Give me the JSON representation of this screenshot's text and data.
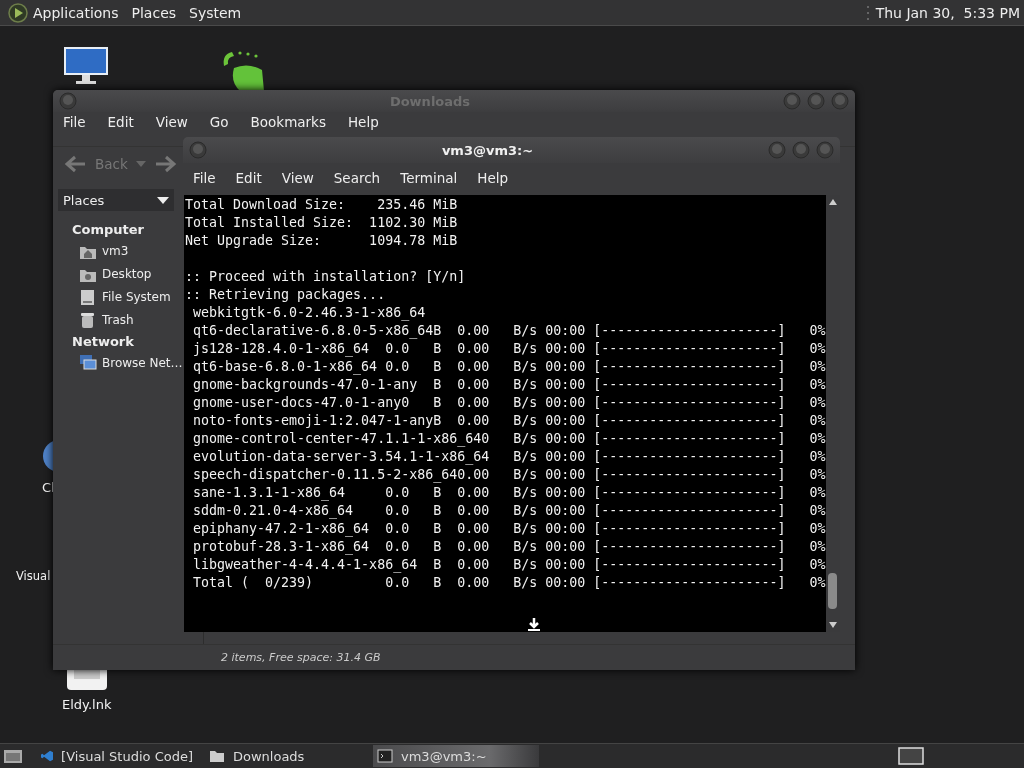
{
  "top_panel": {
    "menus": [
      "Applications",
      "Places",
      "System"
    ],
    "clock": "Thu Jan 30,  5:33 PM"
  },
  "desktop_icons": [
    {
      "kind": "computer"
    },
    {
      "kind": "eldy"
    },
    {
      "kind": "globe",
      "label": "Cl"
    },
    {
      "kind": "blank",
      "label": "Visual"
    },
    {
      "kind": "shortcut",
      "label": "Eldy.lnk"
    }
  ],
  "file_manager": {
    "title": "Downloads",
    "active": false,
    "menus": [
      "File",
      "Edit",
      "View",
      "Go",
      "Bookmarks",
      "Help"
    ],
    "toolbar": {
      "back": {
        "label": "Back",
        "disabled": true
      }
    },
    "sidebar": {
      "selector": "Places",
      "sections": [
        {
          "heading": "Computer",
          "items": [
            {
              "label": "vm3",
              "kind": "home"
            },
            {
              "label": "Desktop",
              "kind": "folder"
            },
            {
              "label": "File System",
              "kind": "drive"
            },
            {
              "label": "Trash",
              "kind": "trash"
            }
          ]
        },
        {
          "heading": "Network",
          "items": [
            {
              "label": "Browse Net…",
              "kind": "network"
            }
          ]
        }
      ]
    },
    "status": "2 items, Free space: 31.4 GB"
  },
  "terminal": {
    "title": "vm3@vm3:~",
    "active": true,
    "menus": [
      "File",
      "Edit",
      "View",
      "Search",
      "Terminal",
      "Help"
    ],
    "summary": [
      "Total Download Size:    235.46 MiB",
      "Total Installed Size:  1102.30 MiB",
      "Net Upgrade Size:      1094.78 MiB"
    ],
    "messages": [
      ":: Proceed with installation? [Y/n]",
      ":: Retrieving packages..."
    ],
    "progress": [
      " webkitgtk-6.0-2.46.3-1-x86_64",
      " qt6-declarative-6.8.0-5-x86_64B  0.00   B/s 00:00 [----------------------]   0%",
      " js128-128.4.0-1-x86_64  0.0   B  0.00   B/s 00:00 [----------------------]   0%",
      " qt6-base-6.8.0-1-x86_64 0.0   B  0.00   B/s 00:00 [----------------------]   0%",
      " gnome-backgrounds-47.0-1-any  B  0.00   B/s 00:00 [----------------------]   0%",
      " gnome-user-docs-47.0-1-any0   B  0.00   B/s 00:00 [----------------------]   0%",
      " noto-fonts-emoji-1:2.047-1-anyB  0.00   B/s 00:00 [----------------------]   0%",
      " gnome-control-center-47.1.1-1-x86_640   B/s 00:00 [----------------------]   0%",
      " evolution-data-server-3.54.1-1-x86_64   B/s 00:00 [----------------------]   0%",
      " speech-dispatcher-0.11.5-2-x86_640.00   B/s 00:00 [----------------------]   0%",
      " sane-1.3.1-1-x86_64     0.0   B  0.00   B/s 00:00 [----------------------]   0%",
      " sddm-0.21.0-4-x86_64    0.0   B  0.00   B/s 00:00 [----------------------]   0%",
      " epiphany-47.2-1-x86_64  0.0   B  0.00   B/s 00:00 [----------------------]   0%",
      " protobuf-28.3-1-x86_64  0.0   B  0.00   B/s 00:00 [----------------------]   0%",
      " libgweather-4-4.4.4-1-x86_64  B  0.00   B/s 00:00 [----------------------]   0%",
      " Total (  0/239)         0.0   B  0.00   B/s 00:00 [----------------------]   0%"
    ]
  },
  "taskbar": {
    "items": [
      {
        "label": "[Visual Studio Code]",
        "kind": "code",
        "selected": false
      },
      {
        "label": "Downloads",
        "kind": "folder",
        "selected": false
      },
      {
        "label": "vm3@vm3:~",
        "kind": "terminal",
        "selected": true
      }
    ]
  }
}
